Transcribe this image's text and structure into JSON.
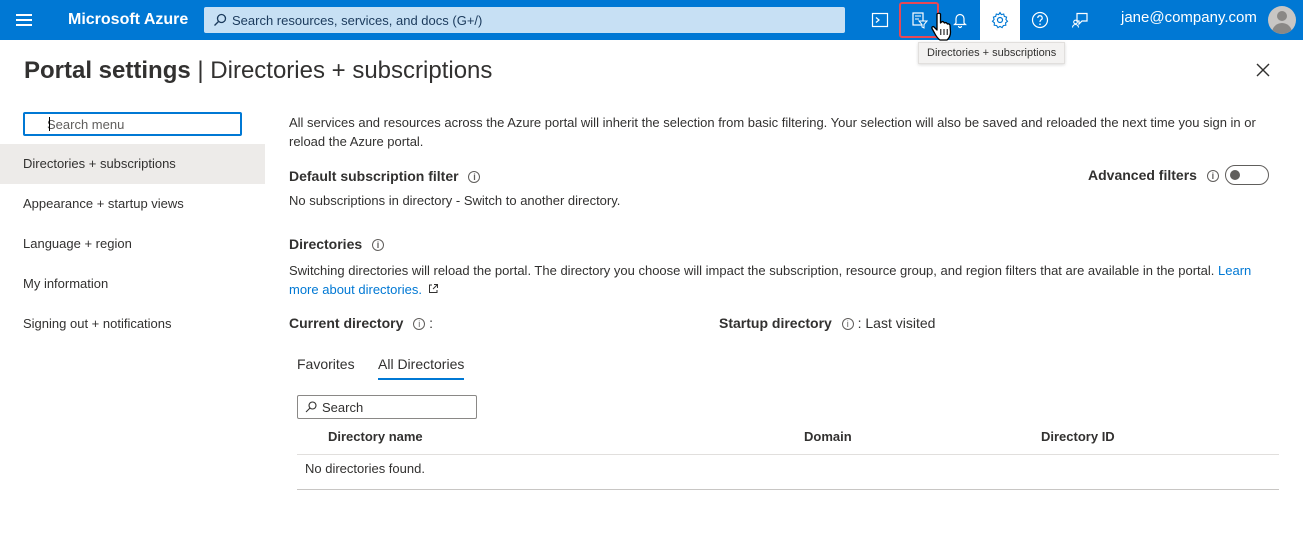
{
  "topbar": {
    "brand": "Microsoft Azure",
    "search_placeholder": "Search resources, services, and docs (G+/)",
    "user": "jane@company.com",
    "icons": [
      "menu-icon",
      "cloud-shell-icon",
      "directories-filter-icon",
      "bell-icon",
      "gear-icon",
      "help-icon",
      "feedback-icon"
    ],
    "accent": "#0078d4"
  },
  "tooltip": "Directories + subscriptions",
  "header": {
    "title_bold": "Portal settings",
    "title_sep": " | ",
    "title_rest": "Directories + subscriptions"
  },
  "sidebar": {
    "search_placeholder": "Search menu",
    "items": [
      {
        "label": "Directories + subscriptions",
        "active": true
      },
      {
        "label": "Appearance + startup views",
        "active": false
      },
      {
        "label": "Language + region",
        "active": false
      },
      {
        "label": "My information",
        "active": false
      },
      {
        "label": "Signing out + notifications",
        "active": false
      }
    ]
  },
  "main": {
    "intro": "All services and resources across the Azure portal will inherit the selection from basic filtering. Your selection will also be saved and reloaded the next time you sign in or reload the Azure portal.",
    "default_filter_label": "Default subscription filter",
    "default_filter_text": "No subscriptions in directory - Switch to another directory.",
    "advanced_filters_label": "Advanced filters",
    "advanced_filters_on": false,
    "directories_label": "Directories",
    "directories_text": "Switching directories will reload the portal. The directory you choose will impact the subscription, resource group, and region filters that are available in the portal.",
    "learn_more_a": "Learn",
    "learn_more_b": "more about directories.",
    "current_directory_label": "Current directory",
    "current_directory_value": ":",
    "startup_directory_label": "Startup directory",
    "startup_directory_value": ": Last visited",
    "tabs": [
      {
        "label": "Favorites",
        "active": false
      },
      {
        "label": "All Directories",
        "active": true
      }
    ],
    "table_search_placeholder": "Search",
    "columns": [
      "Directory name",
      "Domain",
      "Directory ID"
    ],
    "empty_text": "No directories found."
  }
}
